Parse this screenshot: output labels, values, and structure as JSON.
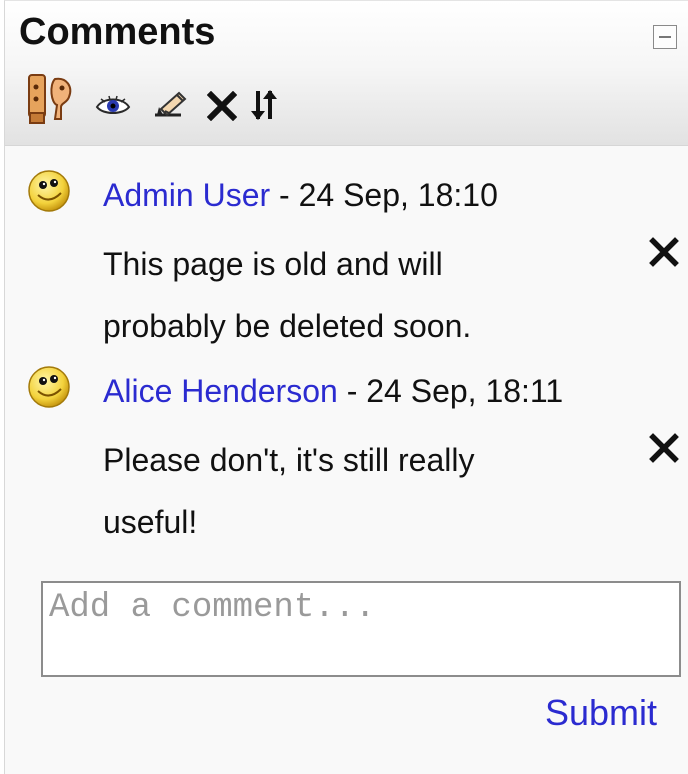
{
  "block": {
    "title": "Comments",
    "collapse_icon": "minus-box-icon"
  },
  "toolbar": {
    "icons": [
      "users-icon",
      "eye-icon",
      "edit-icon",
      "delete-icon",
      "sort-icon"
    ]
  },
  "comments": [
    {
      "author": "Admin User",
      "separator": " - ",
      "timestamp": "24 Sep, 18:10",
      "text": "This page is old and will probably be deleted soon.",
      "avatar_icon": "smiley-avatar-icon",
      "delete_icon": "delete-icon"
    },
    {
      "author": "Alice Henderson",
      "separator": " - ",
      "timestamp": "24 Sep, 18:11",
      "text": "Please don't, it's still really useful!",
      "avatar_icon": "smiley-avatar-icon",
      "delete_icon": "delete-icon"
    }
  ],
  "form": {
    "placeholder": "Add a comment...",
    "value": "",
    "submit_label": "Submit"
  },
  "colors": {
    "link": "#2b2bd0",
    "text": "#111111",
    "header_gradient_bottom": "#e2e2e2"
  }
}
